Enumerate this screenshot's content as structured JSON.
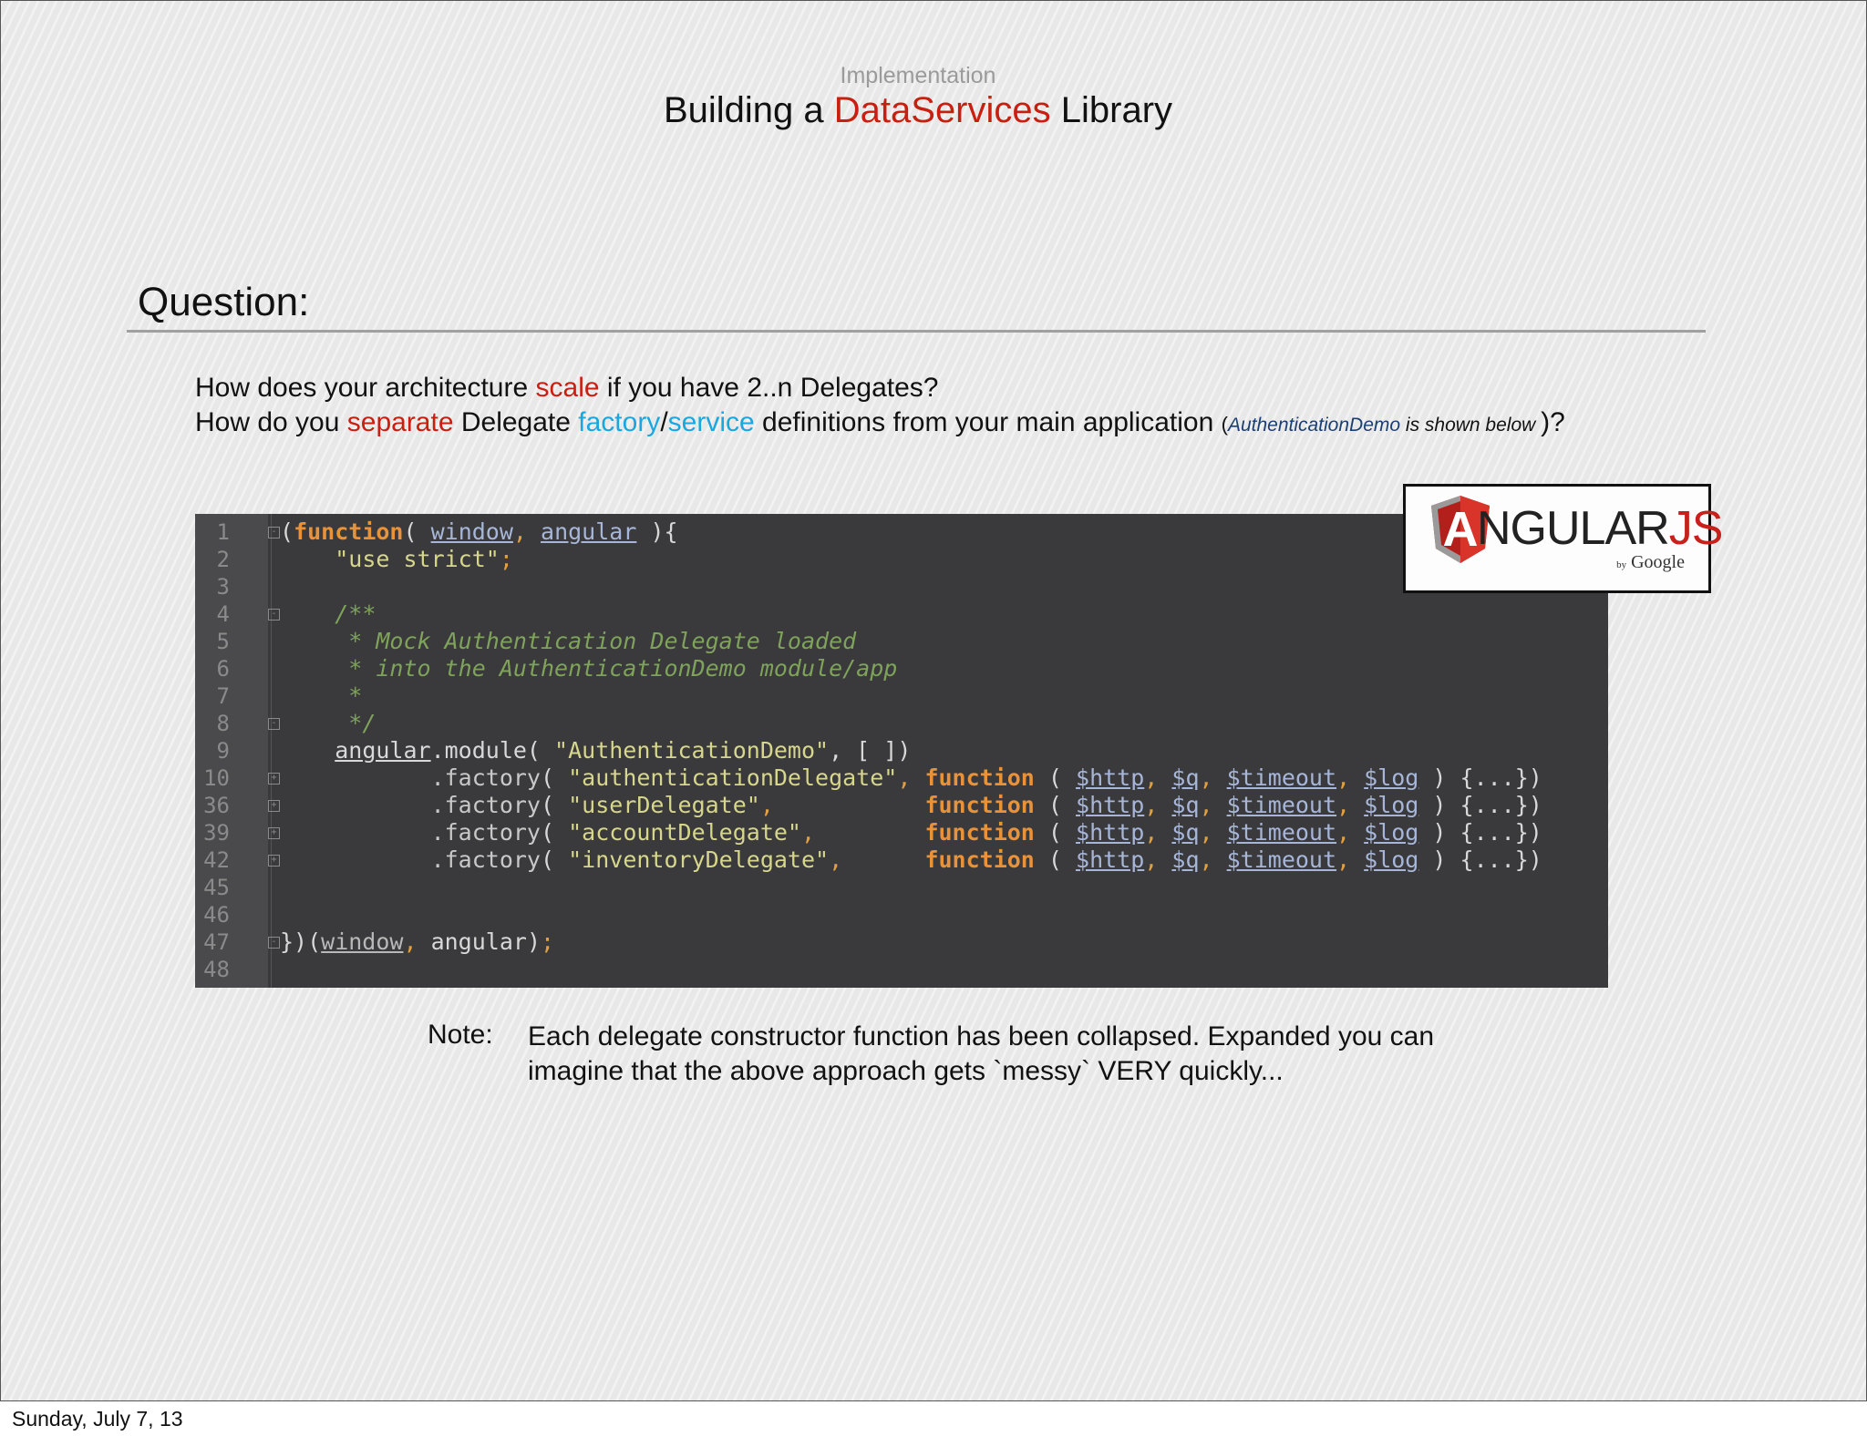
{
  "header": {
    "subtitle": "Implementation",
    "title_prefix": "Building a ",
    "title_highlight": "DataServices",
    "title_suffix": " Library"
  },
  "question": {
    "heading": "Question:",
    "line1_a": "How does your architecture ",
    "line1_red": "scale",
    "line1_b": " if you have 2..n Delegates?",
    "line2_a": "How do you ",
    "line2_red": "separate",
    "line2_b": " Delegate ",
    "line2_blue1": "factory",
    "line2_slash": "/",
    "line2_blue2": "service",
    "line2_c": " definitions from your main application ",
    "line2_paren_open": "(",
    "line2_demo": "AuthenticationDemo",
    "line2_shown": " is shown below ",
    "line2_paren_close": ")?"
  },
  "code": {
    "line_numbers": [
      "1",
      "2",
      "3",
      "4",
      "5",
      "6",
      "7",
      "8",
      "9",
      "10",
      "36",
      "39",
      "42",
      "45",
      "46",
      "47",
      "48"
    ],
    "l1_open": "(",
    "l1_function": "function",
    "l1_paren": "( ",
    "l1_window": "window",
    "l1_comma": ",",
    "l1_angular": "angular",
    "l1_close": " ){",
    "l2_string": "\"use strict\"",
    "l2_semi": ";",
    "l4": "/**",
    "l5": " * Mock Authentication Delegate loaded",
    "l6": " * into the AuthenticationDemo module/app",
    "l7": " *",
    "l8": " */",
    "l9_angular": "angular",
    "l9_module": ".module( ",
    "l9_string": "\"AuthenticationDemo\"",
    "l9_rest": ", [ ])",
    "factory_label": ".factory",
    "factory_open": "( ",
    "delegates": [
      "\"authenticationDelegate\"",
      "\"userDelegate\"",
      "\"accountDelegate\"",
      "\"inventoryDelegate\""
    ],
    "fn_keyword": "function",
    "fn_open": " ( ",
    "p_http": "$http",
    "p_q": "$q",
    "p_timeout": "$timeout",
    "p_log": "$log",
    "fn_collapsed": " ) {...})",
    "l47_close": "})(",
    "l47_window": "window",
    "l47_comma": ",",
    "l47_rest": " angular)",
    "l47_semi": ";"
  },
  "logo": {
    "letter": "A",
    "word": "NGULAR",
    "js": "JS",
    "by": "by",
    "google": "Google"
  },
  "note": {
    "label": "Note:",
    "text": "Each delegate constructor function has been collapsed. Expanded you can imagine that the above approach gets `messy` VERY quickly..."
  },
  "footer": {
    "date": "Sunday, July 7, 13"
  },
  "colors": {
    "accent_red": "#c81f10",
    "accent_blue": "#1aa7e0",
    "code_bg": "#3a3a3c"
  }
}
